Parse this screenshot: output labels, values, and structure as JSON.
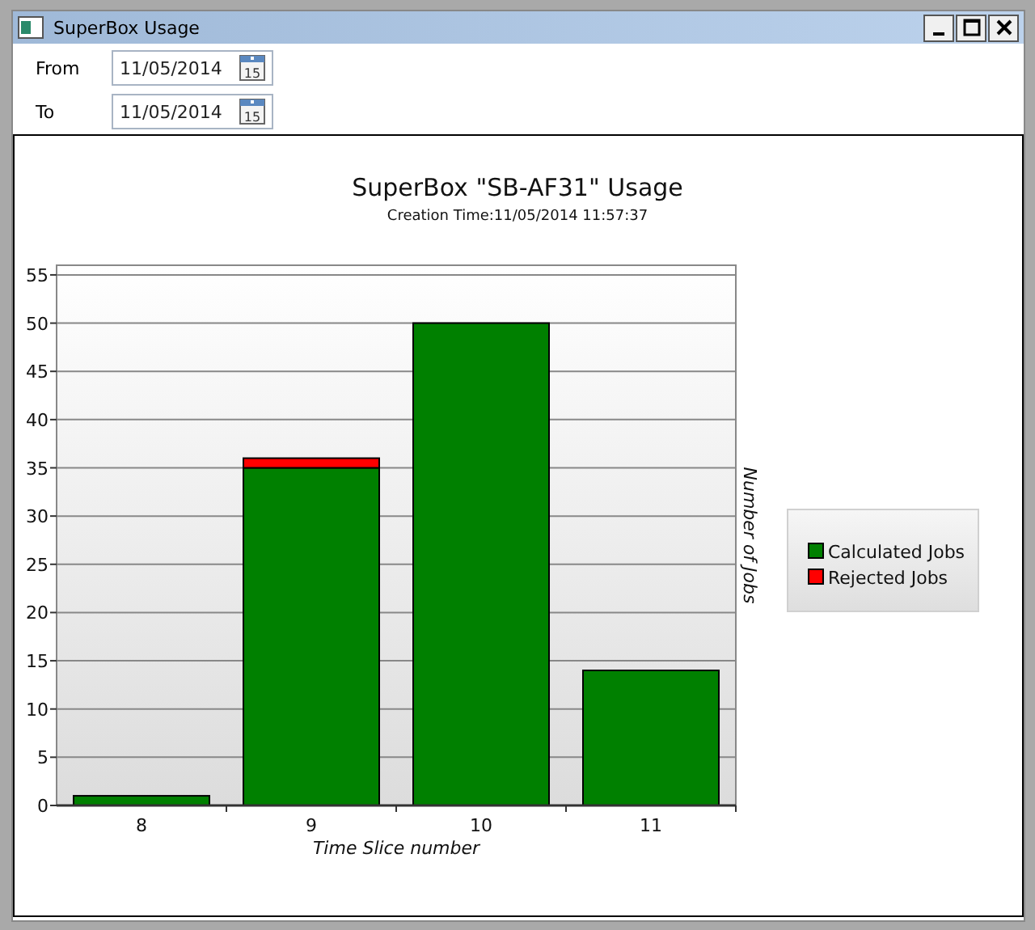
{
  "window": {
    "title": "SuperBox Usage"
  },
  "filters": [
    {
      "label": "From",
      "value": "11/05/2014",
      "calendar_icon_text": "15"
    },
    {
      "label": "To",
      "value": "11/05/2014",
      "calendar_icon_text": "15"
    }
  ],
  "chart": {
    "chart_data": {
      "type": "bar",
      "title": "SuperBox \"SB-AF31\" Usage",
      "subtitle": "Creation Time:11/05/2014 11:57:37",
      "xlabel": "Time Slice number",
      "ylabel": "Number of Jobs",
      "categories": [
        "8",
        "9",
        "10",
        "11"
      ],
      "stacked": true,
      "grid": true,
      "legend": "right",
      "ylim": [
        0,
        56
      ],
      "yticks": [
        0,
        5,
        10,
        15,
        20,
        25,
        30,
        35,
        40,
        45,
        50,
        55
      ],
      "series": [
        {
          "name": "Calculated Jobs",
          "color": "#008000",
          "values": [
            1,
            35,
            50,
            14
          ]
        },
        {
          "name": "Rejected Jobs",
          "color": "#ff0000",
          "values": [
            0,
            1,
            0,
            0
          ]
        }
      ]
    }
  }
}
